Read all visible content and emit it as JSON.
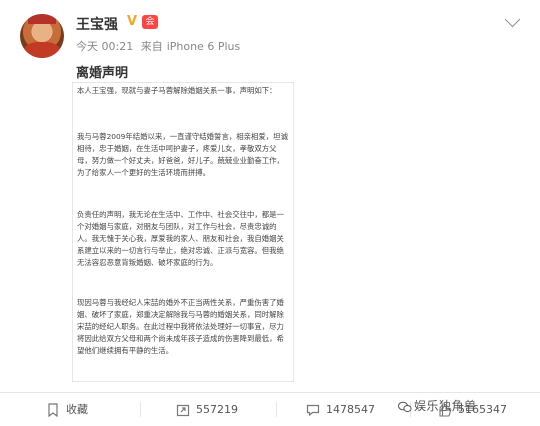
{
  "post": {
    "username": "王宝强",
    "member_badge": "会",
    "timestamp": "今天 00:21",
    "source_prefix": "来自",
    "source_device": "iPhone 6 Plus",
    "title": "离婚声明"
  },
  "document": {
    "paragraphs": [
      "本人王宝强，现就与妻子马蓉解除婚姻关系一事，声明如下：",
      "我与马蓉2009年结婚以来，一直谨守结婚誓言，相亲相爱，坦诚相待，忠于婚姻，在生活中呵护妻子，疼爱儿女，孝敬双方父母，努力做一个好丈夫，好爸爸，好儿子。兢兢业业勤奋工作，为了给家人一个更好的生活环境而拼搏。",
      "负责任的声明，我无论在生活中、工作中、社会交往中，都是一个对婚姻与家庭，对朋友与团队，对工作与社会，尽责忠诚的人。我无愧于关心我，厚爱我的家人、朋友和社会，我自婚姻关系建立以来的一切言行与举止，绝对忠诚、正派与宽容。但我绝无法容忍恶意背叛婚姻、破坏家庭的行为。",
      "现因马蓉与我经纪人宋喆的婚外不正当两性关系，严重伤害了婚姻、破坏了家庭，郑重决定解除我与马蓉的婚姻关系，同时解除宋喆的经纪人职务。在此过程中我将依法处理好一切事宜，尽力将因此给双方父母和两个尚未成年孩子造成的伤害降到最低，希望他们继续拥有平静的生活。"
    ]
  },
  "footer": {
    "favorite_label": "收藏",
    "repost_count": "557219",
    "comment_count": "1478547",
    "like_count": "5165347"
  },
  "watermark": {
    "text": "娱乐独角兽"
  },
  "colors": {
    "vip_badge": "#f5a623",
    "member_badge": "#ff4444",
    "meta_text": "#888888"
  }
}
